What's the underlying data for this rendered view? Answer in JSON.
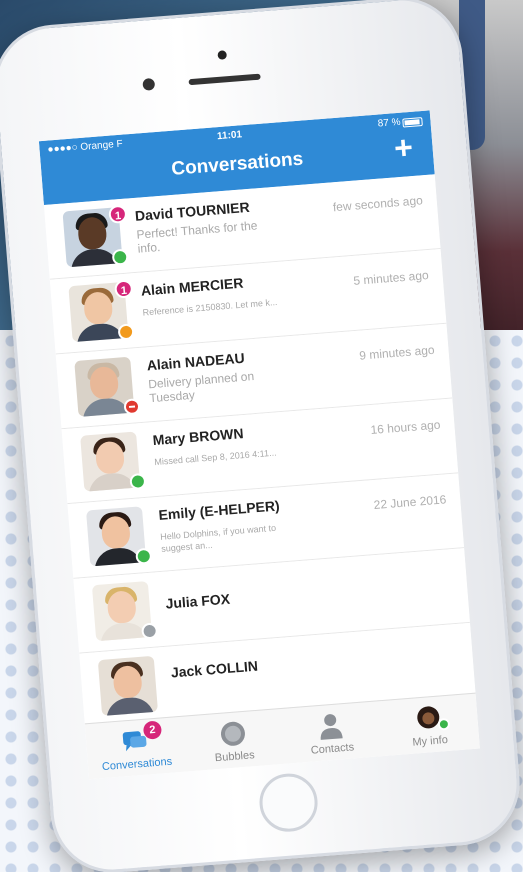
{
  "status_bar": {
    "carrier": "●●●●○ Orange F",
    "time": "11:01",
    "battery": "87 %"
  },
  "header": {
    "title": "Conversations",
    "add_label": "+"
  },
  "conversations": [
    {
      "name": "David TOURNIER",
      "preview": "Perfect! Thanks for the info.",
      "time": "few seconds ago",
      "unread": "1",
      "presence": "online"
    },
    {
      "name": "Alain MERCIER",
      "preview": "Reference is 2150830. Let me k...",
      "time": "5 minutes ago",
      "unread": "1",
      "presence": "away"
    },
    {
      "name": "Alain NADEAU",
      "preview": "Delivery planned on Tuesday",
      "time": "9 minutes ago",
      "unread": "",
      "presence": "dnd"
    },
    {
      "name": "Mary BROWN",
      "preview": "Missed call Sep 8, 2016 4:11...",
      "time": "16 hours ago",
      "unread": "",
      "presence": "online"
    },
    {
      "name": "Emily (E-HELPER)",
      "preview": "Hello Dolphins, if you want to suggest an...",
      "time": "22 June 2016",
      "unread": "",
      "presence": "online"
    },
    {
      "name": "Julia FOX",
      "preview": "",
      "time": "",
      "unread": "",
      "presence": "offline"
    },
    {
      "name": "Jack COLLIN",
      "preview": "",
      "time": "",
      "unread": "",
      "presence": ""
    }
  ],
  "tabs": [
    {
      "label": "Conversations",
      "badge": "2",
      "icon": "chat-bubbles-icon"
    },
    {
      "label": "Bubbles",
      "icon": "bubble-icon"
    },
    {
      "label": "Contacts",
      "icon": "person-icon"
    },
    {
      "label": "My info",
      "icon": "avatar-icon"
    }
  ],
  "colors": {
    "brand": "#2f8ad6",
    "unread": "#d6267a",
    "online": "#3bb54a",
    "away": "#f29a1d",
    "dnd": "#e0392f",
    "offline": "#9aa0a6"
  }
}
